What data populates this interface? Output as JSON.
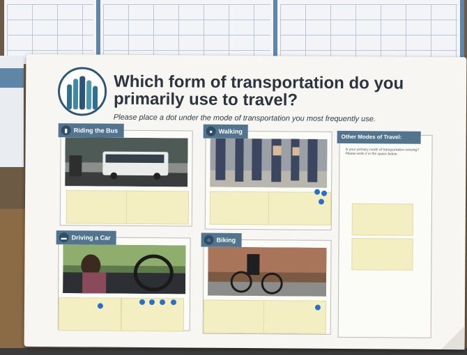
{
  "poster": {
    "title": "Which form of transportation do you primarily use to travel?",
    "subtitle": "Please place a dot under the mode of transportation you most frequently use."
  },
  "panels": [
    {
      "id": "bus",
      "label": "Riding the Bus",
      "icon": "bus-icon",
      "dots": 0
    },
    {
      "id": "walk",
      "label": "Walking",
      "icon": "pedestrian-icon",
      "dots": 3
    },
    {
      "id": "car",
      "label": "Driving a Car",
      "icon": "car-icon",
      "dots": 5
    },
    {
      "id": "bike",
      "label": "Biking",
      "icon": "bicycle-icon",
      "dots": 1
    }
  ],
  "other": {
    "label": "Other Modes of Travel:",
    "note": "Is your primary mode of transportation missing? Please write it in the space below."
  },
  "colors": {
    "dot": "#2a6fc7",
    "accent": "#52748f",
    "sticky": "#f4efc2"
  }
}
